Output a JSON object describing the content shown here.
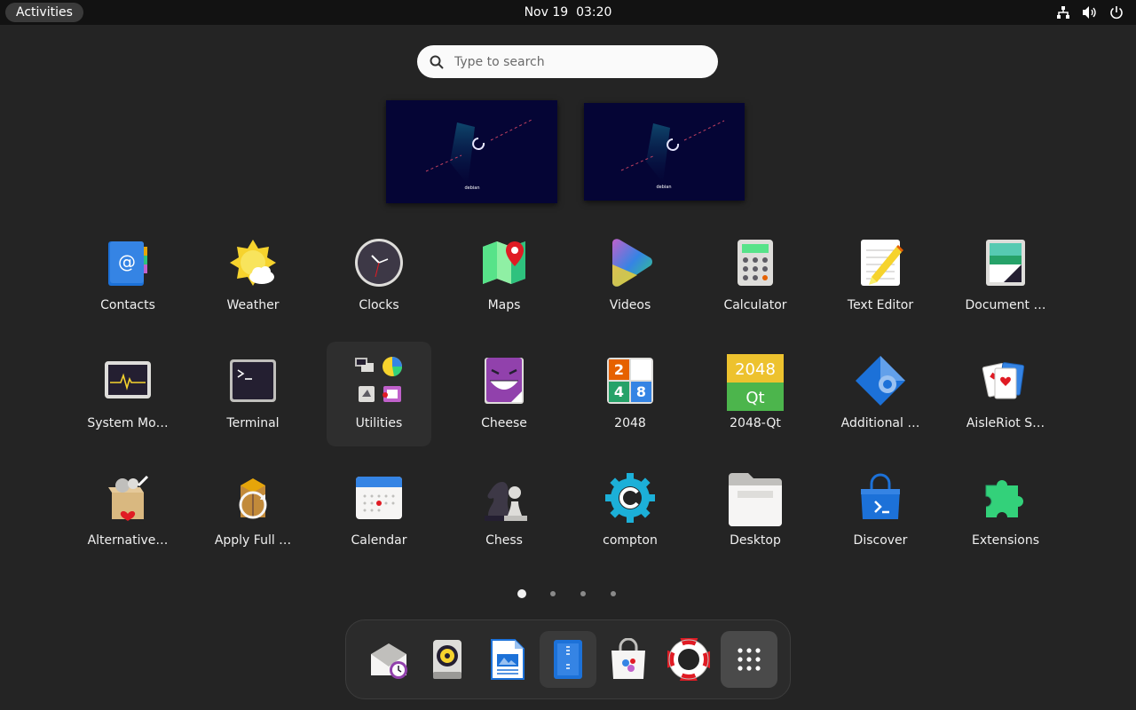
{
  "topbar": {
    "activities": "Activities",
    "date": "Nov 19",
    "time": "03:20",
    "tray": [
      "network-icon",
      "volume-icon",
      "power-icon"
    ]
  },
  "search": {
    "placeholder": "Type to search"
  },
  "workspaces": [
    {
      "logo_text": "debian"
    },
    {
      "logo_text": "debian"
    }
  ],
  "apps": [
    {
      "label": "Contacts",
      "icon": "contacts-icon"
    },
    {
      "label": "Weather",
      "icon": "weather-icon"
    },
    {
      "label": "Clocks",
      "icon": "clock-icon"
    },
    {
      "label": "Maps",
      "icon": "maps-icon"
    },
    {
      "label": "Videos",
      "icon": "videos-icon"
    },
    {
      "label": "Calculator",
      "icon": "calculator-icon"
    },
    {
      "label": "Text Editor",
      "icon": "text-editor-icon"
    },
    {
      "label": "Document …",
      "icon": "document-viewer-icon"
    },
    {
      "label": "System Mo…",
      "icon": "system-monitor-icon"
    },
    {
      "label": "Terminal",
      "icon": "terminal-icon"
    },
    {
      "label": "Utilities",
      "icon": "utilities-folder-icon"
    },
    {
      "label": "Cheese",
      "icon": "cheese-icon"
    },
    {
      "label": "2048",
      "icon": "2048-icon"
    },
    {
      "label": "2048-Qt",
      "icon": "2048-qt-icon",
      "tile_top": "2048",
      "tile_bottom": "Qt"
    },
    {
      "label": "Additional …",
      "icon": "additional-drivers-icon"
    },
    {
      "label": "AisleRiot S…",
      "icon": "aisleriot-icon"
    },
    {
      "label": "Alternative…",
      "icon": "alternatives-icon"
    },
    {
      "label": "Apply Full …",
      "icon": "apply-full-upgrade-icon"
    },
    {
      "label": "Calendar",
      "icon": "calendar-icon"
    },
    {
      "label": "Chess",
      "icon": "chess-icon"
    },
    {
      "label": "compton",
      "icon": "compton-icon"
    },
    {
      "label": "Desktop",
      "icon": "folder-icon"
    },
    {
      "label": "Discover",
      "icon": "discover-icon"
    },
    {
      "label": "Extensions",
      "icon": "extensions-icon"
    }
  ],
  "tile_2048_digits": [
    "2",
    "4",
    "8"
  ],
  "pager": {
    "pages": 4,
    "current": 1
  },
  "dock": [
    {
      "name": "evolution-icon"
    },
    {
      "name": "rhythmbox-icon"
    },
    {
      "name": "libreoffice-writer-icon"
    },
    {
      "name": "document-viewer-dock-icon",
      "running": true
    },
    {
      "name": "software-icon"
    },
    {
      "name": "help-icon"
    },
    {
      "name": "show-apps-grid-icon"
    }
  ]
}
